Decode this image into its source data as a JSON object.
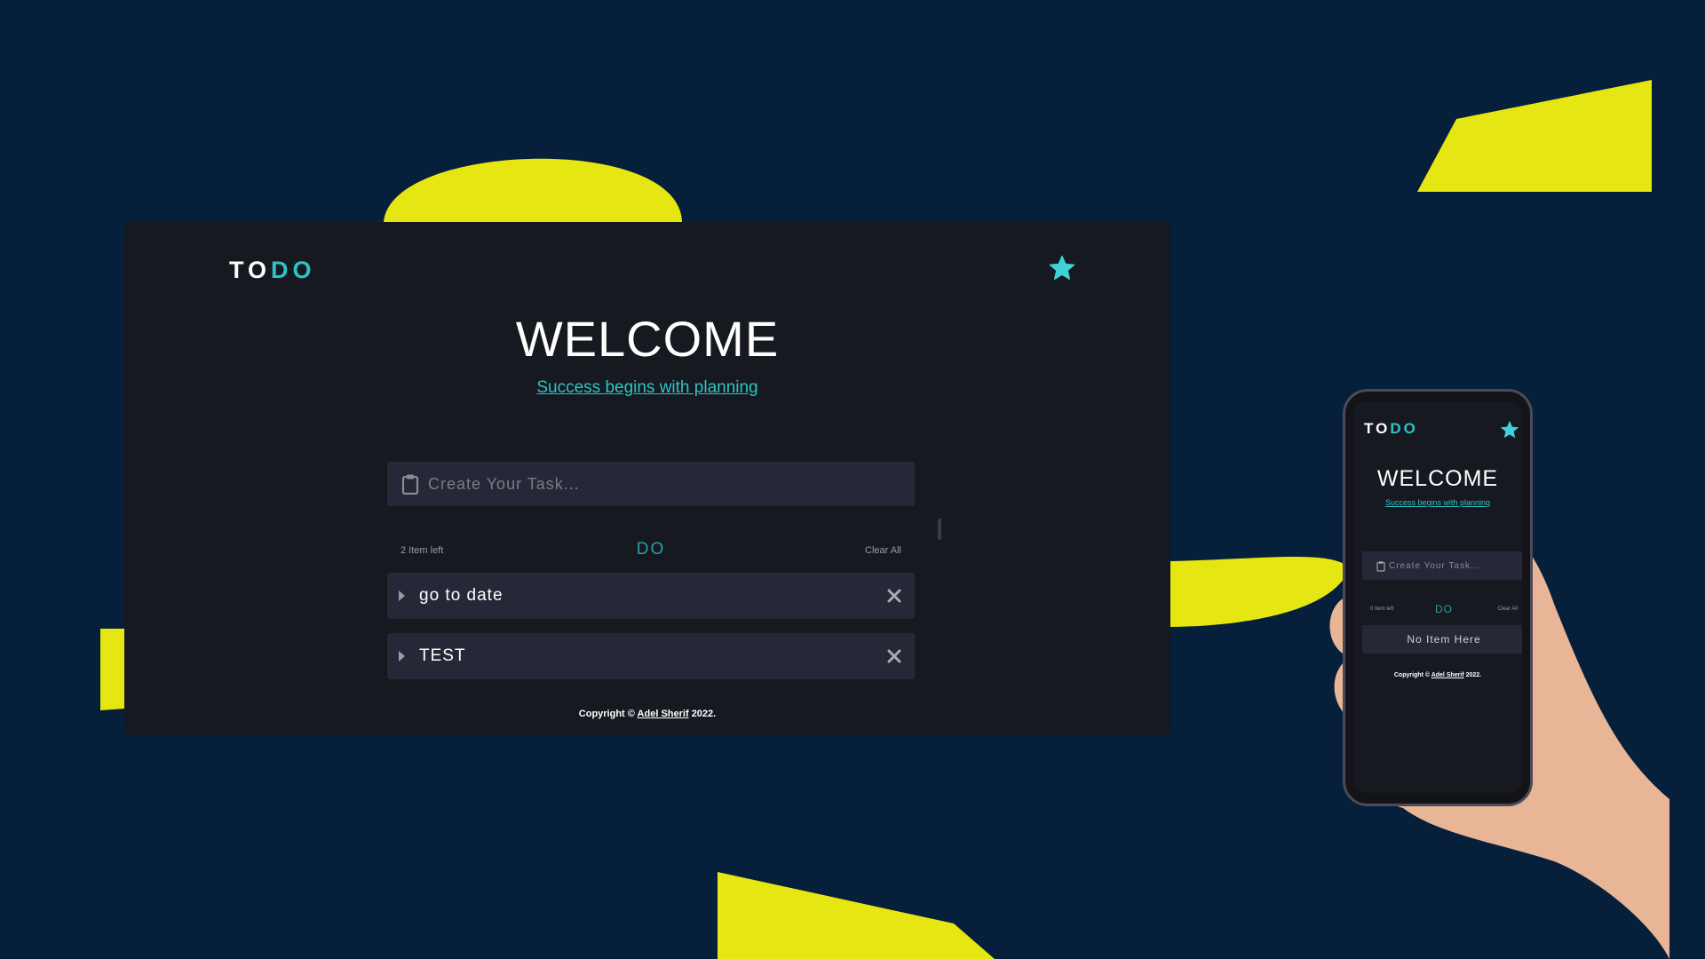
{
  "colors": {
    "background": "#061f3b",
    "accent_yellow": "#e6e612",
    "panel": "#171921",
    "field": "#262838",
    "teal": "#2ec4c4"
  },
  "app": {
    "logo_part1": "TO",
    "logo_part2": "DO",
    "title": "WELCOME",
    "tagline": "Success begins with planning",
    "input_placeholder": "Create Your Task...",
    "items_left": "2 Item left",
    "filter_label": "DO",
    "clear_all": "Clear All",
    "todos": [
      {
        "label": "go to date"
      },
      {
        "label": "TEST"
      }
    ],
    "footer_prefix": "Copyright ©",
    "footer_author": "Adel Sherif",
    "footer_suffix": "2022.",
    "star_icon": "star-icon",
    "clipboard_icon": "clipboard-icon"
  },
  "phone": {
    "logo_part1": "TO",
    "logo_part2": "DO",
    "title": "WELCOME",
    "tagline": "Success begins with planning",
    "input_placeholder": "Create Your Task...",
    "items_left": "0 Item left",
    "filter_label": "DO",
    "clear_all": "Clear All",
    "empty_message": "No Item Here",
    "footer_prefix": "Copyright ©",
    "footer_author": "Adel Sherif",
    "footer_suffix": "2022."
  }
}
